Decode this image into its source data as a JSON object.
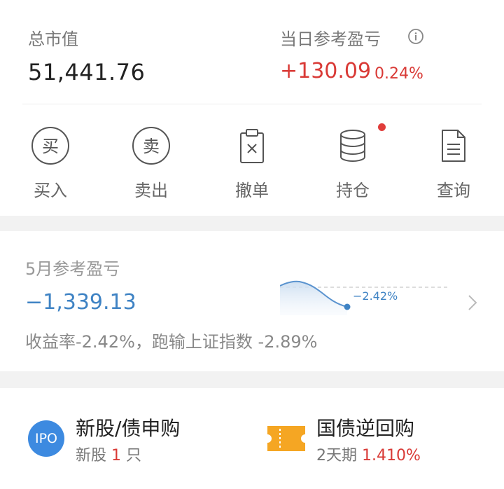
{
  "summary": {
    "total_label": "总市值",
    "total_value": "51,441.76",
    "pnl_label": "当日参考盈亏",
    "pnl_value": "+130.09",
    "pnl_pct": "0.24%",
    "info_icon": "info-icon"
  },
  "actions": [
    {
      "label": "买入",
      "icon": "buy-circle-icon",
      "glyph": "买"
    },
    {
      "label": "卖出",
      "icon": "sell-circle-icon",
      "glyph": "卖"
    },
    {
      "label": "撤单",
      "icon": "cancel-order-icon"
    },
    {
      "label": "持仓",
      "icon": "database-icon",
      "has_notification_dot": true
    },
    {
      "label": "查询",
      "icon": "document-icon"
    }
  ],
  "month": {
    "title": "5月参考盈亏",
    "value": "−1,339.13",
    "rate_text": "收益率-2.42%，跑输上证指数 -2.89%",
    "sparkline_label": "−2.42%"
  },
  "bottom": {
    "ipo": {
      "badge": "IPO",
      "title": "新股/债申购",
      "sub_prefix": "新股",
      "sub_count": "1",
      "sub_suffix": "只"
    },
    "repo": {
      "title": "国债逆回购",
      "sub_prefix": "2天期",
      "sub_rate": "1.410%"
    }
  },
  "colors": {
    "red": "#d93a36",
    "blue": "#3f83c4",
    "accent_orange": "#f5a623"
  }
}
